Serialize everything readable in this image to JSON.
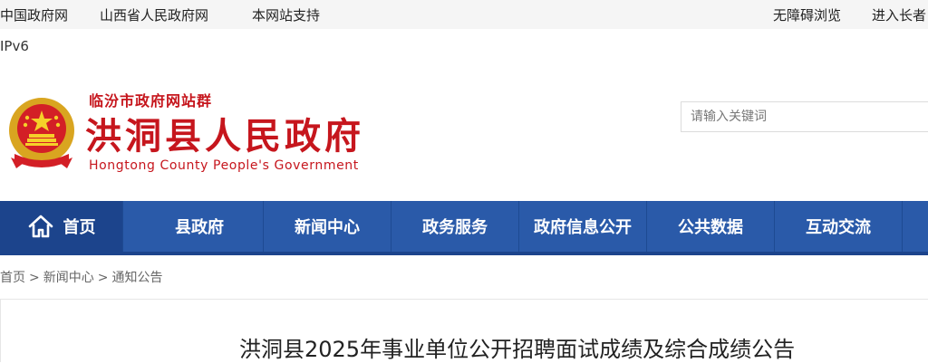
{
  "topbar": {
    "links": [
      "中国政府网",
      "山西省人民政府网",
      "本网站支持"
    ],
    "right_links": [
      "无障碍浏览",
      "进入长者"
    ]
  },
  "ipv6": "IPv6",
  "header": {
    "site_group": "临汾市政府网站群",
    "title": "洪洞县人民政府",
    "title_en": "Hongtong County People's Government",
    "emblem_icon": "national-emblem-icon"
  },
  "search": {
    "placeholder": "请输入关键词"
  },
  "nav": {
    "items": [
      "首页",
      "县政府",
      "新闻中心",
      "政务服务",
      "政府信息公开",
      "公共数据",
      "互动交流"
    ],
    "active": "首页"
  },
  "breadcrumb": {
    "items": [
      "首页",
      "新闻中心",
      "通知公告"
    ],
    "separator": ">"
  },
  "article": {
    "title": "洪洞县2025年事业单位公开招聘面试成绩及综合成绩公告"
  },
  "colors": {
    "brand_red": "#c6161d",
    "nav_blue": "#2a5aa9",
    "nav_active": "#1c448c"
  }
}
